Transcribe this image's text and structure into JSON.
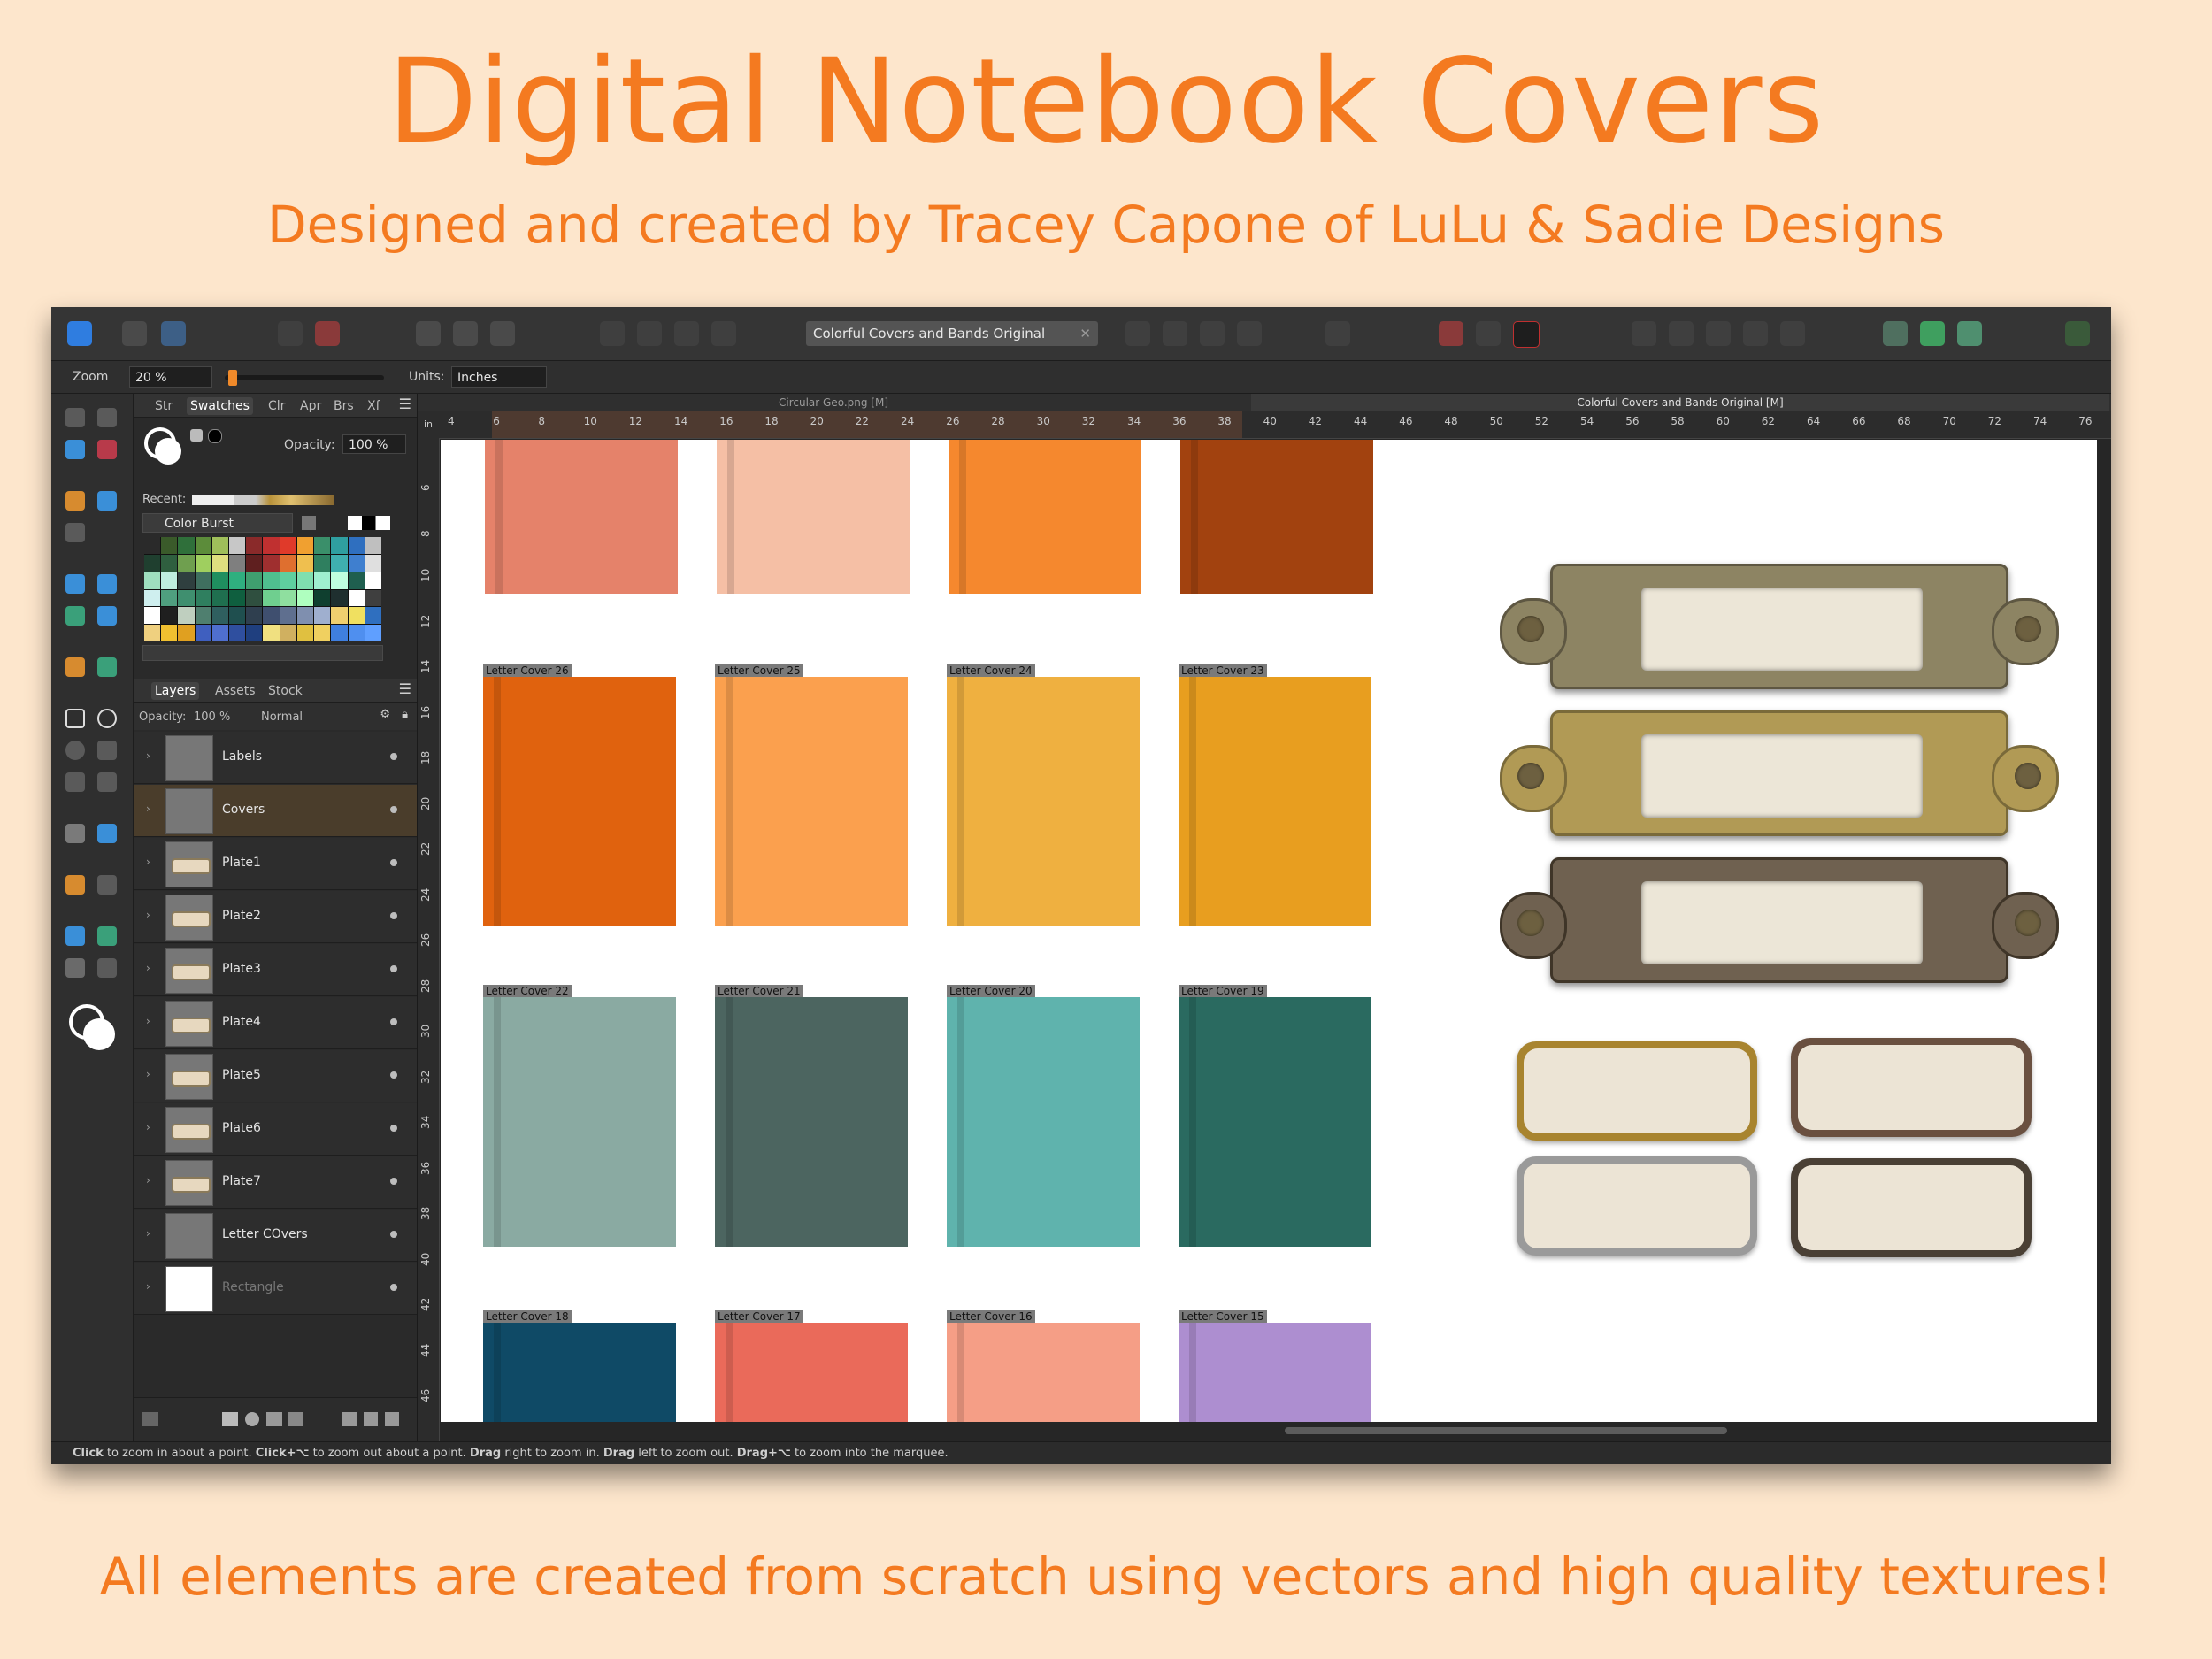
{
  "banner": {
    "title": "Digital Notebook Covers",
    "subtitle": "Designed and created by Tracey Capone of LuLu & Sadie Designs",
    "footer": "All elements are created from scratch using vectors and high quality textures!"
  },
  "toolbar": {
    "document_title": "Colorful Covers and Bands Original"
  },
  "context_bar": {
    "zoom_label": "Zoom",
    "zoom_value": "20 %",
    "zoom_level_percent": 20,
    "units_label": "Units:",
    "units_value": "Inches"
  },
  "swatches_panel": {
    "tabs": [
      "Str",
      "Swatches",
      "Clr",
      "Apr",
      "Brs",
      "Xf"
    ],
    "active_tab": "Swatches",
    "opacity_label": "Opacity:",
    "opacity_value": "100 %",
    "recent_label": "Recent:",
    "palette_name": "Color Burst",
    "palette_colors": [
      "#2a2a2a",
      "#3a5a2a",
      "#2f6f3a",
      "#5c8c3a",
      "#9fbf5a",
      "#c7c7c7",
      "#8a2a2a",
      "#c03030",
      "#e03a2a",
      "#f0a030",
      "#3a8f6a",
      "#2f9fa0",
      "#2f6fbf",
      "#bfbfbf",
      "#1f3f2f",
      "#2f5f3f",
      "#6f9f4f",
      "#9fcf5f",
      "#dfdf7f",
      "#7f7f7f",
      "#5f1f1f",
      "#9f2f2f",
      "#df6f2f",
      "#efbf4f",
      "#2f7f5f",
      "#3fafaf",
      "#3f7fcf",
      "#dfdfdf",
      "#9fdfbf",
      "#bfefdf",
      "#2f3f3f",
      "#3f6f5f",
      "#1f8f5f",
      "#2faf7f",
      "#3f9f6f",
      "#4fbf8f",
      "#5fcf9f",
      "#7fdfaf",
      "#9fefcf",
      "#bfffdf",
      "#1f5f4f",
      "#ffffff",
      "#cfefef",
      "#4f9f7f",
      "#3f8f6f",
      "#2f7f5f",
      "#1f6f4f",
      "#0f5f3f",
      "#2f4f3f",
      "#6fcf8f",
      "#8fdf9f",
      "#afffbf",
      "#0f3f2f",
      "#1f2f2f",
      "#ffffff",
      "#3f3f3f",
      "#ffffff",
      "#1f1f1f",
      "#bfcfbf",
      "#4f7f6f",
      "#2f5f5f",
      "#1f4f4f",
      "#2f3f4f",
      "#3f4f6f",
      "#5f6f8f",
      "#7f8faf",
      "#9fafcf",
      "#efcf6f",
      "#f0e060",
      "#2f6fbf",
      "#efd07f",
      "#f0c030",
      "#e0a020",
      "#3f5fbf",
      "#4f6fcf",
      "#2f4f9f",
      "#1f3f7f",
      "#f0e080",
      "#d0b060",
      "#e0c040",
      "#f0d060",
      "#3f7fdf",
      "#4f8fef",
      "#5f9fff"
    ]
  },
  "layers_panel": {
    "tabs": [
      "Layers",
      "Assets",
      "Stock"
    ],
    "active_tab": "Layers",
    "opacity_label": "Opacity:",
    "opacity_value": "100 %",
    "blend_mode": "Normal",
    "layers": [
      {
        "name": "Labels",
        "selected": false
      },
      {
        "name": "Covers",
        "selected": true
      },
      {
        "name": "Plate1",
        "selected": false
      },
      {
        "name": "Plate2",
        "selected": false
      },
      {
        "name": "Plate3",
        "selected": false
      },
      {
        "name": "Plate4",
        "selected": false
      },
      {
        "name": "Plate5",
        "selected": false
      },
      {
        "name": "Plate6",
        "selected": false
      },
      {
        "name": "Plate7",
        "selected": false
      },
      {
        "name": "Letter COvers",
        "selected": false
      },
      {
        "name": "Rectangle",
        "selected": false
      }
    ]
  },
  "document_tabs": {
    "inactive": "Circular Geo.png [M]",
    "active": "Colorful Covers and Bands Original  [M]"
  },
  "ruler": {
    "unit": "in",
    "horizontal_ticks": [
      "4",
      "6",
      "8",
      "10",
      "12",
      "14",
      "16",
      "18",
      "20",
      "22",
      "24",
      "26",
      "28",
      "30",
      "32",
      "34",
      "36",
      "38",
      "40",
      "42",
      "44",
      "46",
      "48",
      "50",
      "52",
      "54",
      "56",
      "58",
      "60",
      "62",
      "64",
      "66",
      "68",
      "70",
      "72",
      "74",
      "76"
    ],
    "vertical_ticks": [
      "6",
      "8",
      "10",
      "12",
      "14",
      "16",
      "18",
      "20",
      "22",
      "24",
      "26",
      "28",
      "30",
      "32",
      "34",
      "36",
      "38",
      "40",
      "42",
      "44",
      "46",
      "8"
    ]
  },
  "covers": {
    "top_row_colors": [
      "#e5826a",
      "#f5bfa5",
      "#f5882e",
      "#a2420f"
    ],
    "rows": [
      {
        "labels": [
          "Letter Cover 26",
          "Letter Cover 25",
          "Letter Cover 24",
          "Letter Cover 23"
        ],
        "colors": [
          "#e0620e",
          "#fba04e",
          "#efb040",
          "#e89e1f"
        ]
      },
      {
        "labels": [
          "Letter Cover 22",
          "Letter Cover 21",
          "Letter Cover 20",
          "Letter Cover 19"
        ],
        "colors": [
          "#8aaaa2",
          "#4c6560",
          "#5fb3ad",
          "#2a6a60"
        ]
      },
      {
        "labels": [
          "Letter Cover 18",
          "Letter Cover 17",
          "Letter Cover 16",
          "Letter Cover 15"
        ],
        "colors": [
          "#0f4a66",
          "#ea6a5a",
          "#f59e86",
          "#ad8ed0"
        ]
      }
    ]
  },
  "plates": {
    "large": [
      {
        "color": "#8d8463",
        "rim": "#5e5742"
      },
      {
        "color": "#b19a55",
        "rim": "#7a6a3a"
      },
      {
        "color": "#6f6150",
        "rim": "#3f3528"
      }
    ],
    "small": [
      {
        "color": "#a8842f"
      },
      {
        "color": "#6a5040"
      },
      {
        "color": "#9a9a9a"
      },
      {
        "color": "#4a4035"
      }
    ]
  },
  "status": {
    "bold1": "Click",
    "text1": " to zoom in about a point. ",
    "bold2": "Click+⌥",
    "text2": " to zoom out about a point. ",
    "bold3": "Drag",
    "text3": " right to zoom in. ",
    "bold4": "Drag",
    "text4": " left to zoom out. ",
    "bold5": "Drag+⌥",
    "text5": " to zoom into the marquee."
  }
}
